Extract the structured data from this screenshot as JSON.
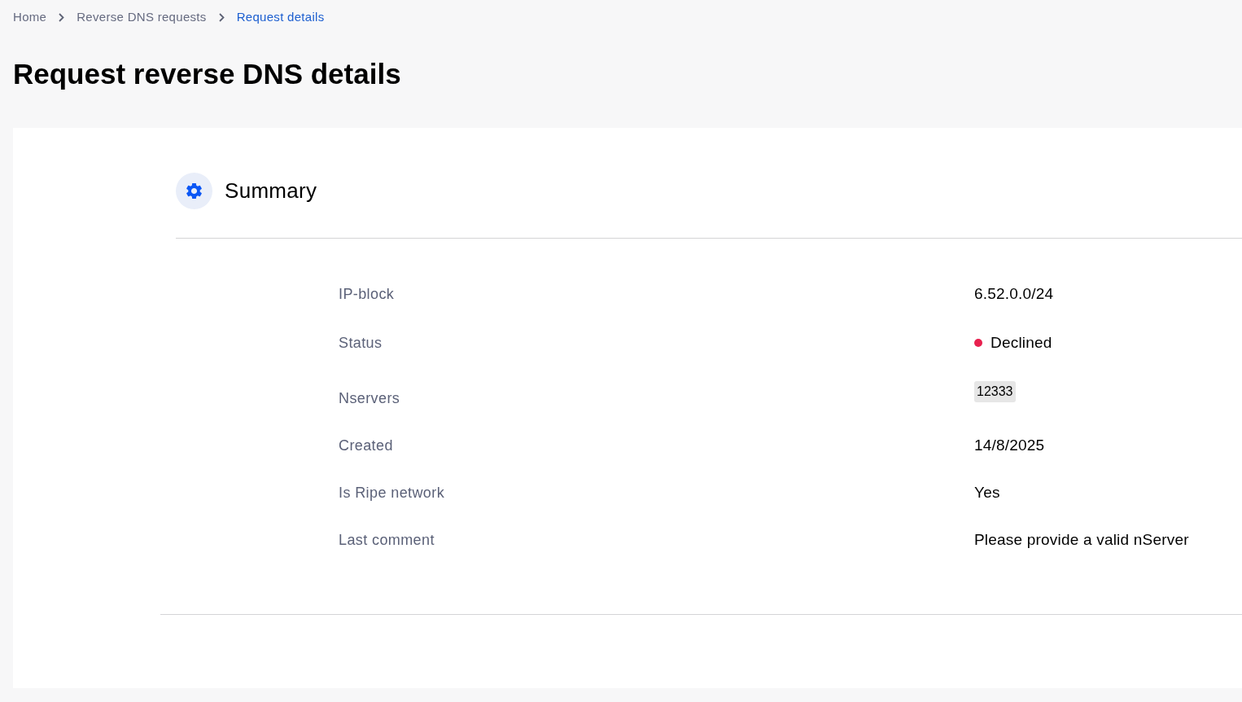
{
  "breadcrumbs": [
    {
      "label": "Home",
      "selected": false
    },
    {
      "label": "Reverse DNS requests",
      "selected": false
    },
    {
      "label": "Request details",
      "selected": true
    }
  ],
  "title": "Request reverse DNS details",
  "summary": {
    "title": "Summary",
    "rows": [
      {
        "kind": "text",
        "label": "IP-block",
        "value": "6.52.0.0/24"
      },
      {
        "kind": "status",
        "label": "Status",
        "value": "Declined",
        "color": "#e8214f"
      },
      {
        "kind": "tag",
        "label": "Nservers",
        "value": "12333"
      },
      {
        "kind": "text",
        "label": "Created",
        "value": "14/8/2025"
      },
      {
        "kind": "text",
        "label": "Is Ripe network",
        "value": "Yes"
      },
      {
        "kind": "text",
        "label": "Last comment",
        "value": "Please provide a valid nServer"
      }
    ]
  }
}
